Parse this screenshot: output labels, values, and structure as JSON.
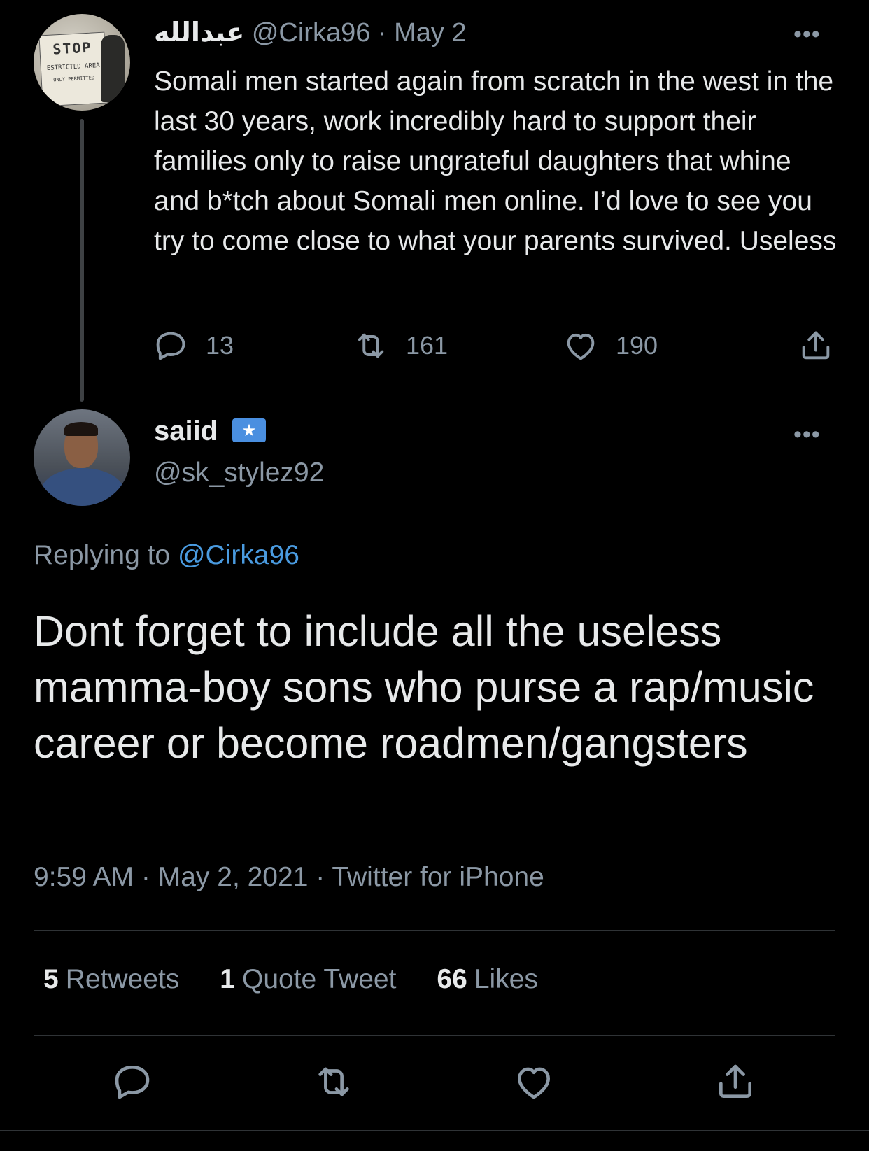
{
  "parent_tweet": {
    "display_name": "عبدالله",
    "handle": "@Cirka96",
    "separator": "·",
    "date": "May 2",
    "text": "Somali men started again from scratch in the west in the last 30 years, work incredibly hard to support their families only to raise ungrateful daughters that whine and b*tch about Somali men online. I’d love to see you try to come close to what your parents survived. Useless",
    "avatar_sign": {
      "top": "STOP",
      "middle": "ESTRICTED AREA",
      "bottom": "ONLY PERMITTED"
    },
    "more_label": "•••",
    "replies": "13",
    "retweets": "161",
    "likes": "190"
  },
  "reply_tweet": {
    "display_name": "saiid",
    "flag_symbol": "★",
    "handle": "@sk_stylez92",
    "more_label": "•••",
    "replying_prefix": "Replying to",
    "replying_to": "@Cirka96",
    "text": "Dont forget to include all the useless mamma-boy sons who purse a rap/music career or become roadmen/gangsters",
    "timestamp": "9:59 AM · May 2, 2021 · Twitter for iPhone",
    "stats": {
      "retweets_count": "5",
      "retweets_label": "Retweets",
      "quotes_count": "1",
      "quotes_label": "Quote Tweet",
      "likes_count": "66",
      "likes_label": "Likes"
    }
  },
  "icons": [
    "reply-icon",
    "retweet-icon",
    "like-icon",
    "share-icon"
  ]
}
